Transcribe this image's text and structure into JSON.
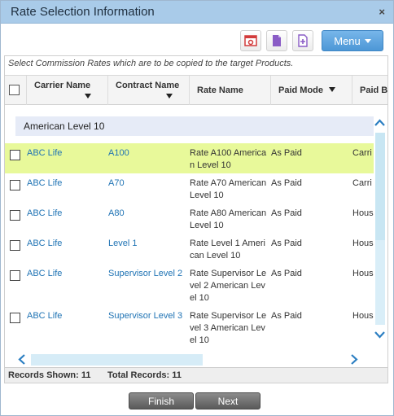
{
  "dialog": {
    "title": "Rate Selection Information",
    "close_glyph": "×"
  },
  "toolbar": {
    "icons": [
      "export-icon",
      "document-icon",
      "add-document-icon"
    ],
    "menu_label": "Menu"
  },
  "hint": "Select Commission Rates which are to be copied to the target Products.",
  "columns": {
    "carrier": "Carrier Name",
    "contract": "Contract Name",
    "rate": "Rate Name",
    "paid_mode": "Paid Mode",
    "paid_by": "Paid By"
  },
  "group_label": "American Level 10",
  "rows": [
    {
      "carrier": "ABC Life",
      "contract": "A100",
      "rate": "Rate A100 American Level 10",
      "paid_mode": "As Paid",
      "paid_by": "Carri",
      "highlighted": true
    },
    {
      "carrier": "ABC Life",
      "contract": "A70",
      "rate": "Rate A70 American Level 10",
      "paid_mode": "As Paid",
      "paid_by": "Carri",
      "highlighted": false
    },
    {
      "carrier": "ABC Life",
      "contract": "A80",
      "rate": "Rate A80 American Level 10",
      "paid_mode": "As Paid",
      "paid_by": "Hous",
      "highlighted": false
    },
    {
      "carrier": "ABC Life",
      "contract": "Level 1",
      "rate": "Rate Level 1 American Level 10",
      "paid_mode": "As Paid",
      "paid_by": "Hous",
      "highlighted": false
    },
    {
      "carrier": "ABC Life",
      "contract": "Supervisor Level 2",
      "rate": "Rate Supervisor Level 2 American Level 10",
      "paid_mode": "As Paid",
      "paid_by": "Hous",
      "highlighted": false
    },
    {
      "carrier": "ABC Life",
      "contract": "Supervisor Level 3",
      "rate": "Rate Supervisor Level 3 American Level 10",
      "paid_mode": "As Paid",
      "paid_by": "Hous",
      "highlighted": false
    }
  ],
  "status": {
    "shown": "Records Shown: 11",
    "total": "Total Records: 11"
  },
  "buttons": {
    "finish": "Finish",
    "next": "Next"
  },
  "colors": {
    "title_bar": "#a9cbe9",
    "menu": "#4d97d6",
    "link": "#1f73b4",
    "highlight_row": "#e8f99a",
    "group_band": "#e6ebf7"
  }
}
